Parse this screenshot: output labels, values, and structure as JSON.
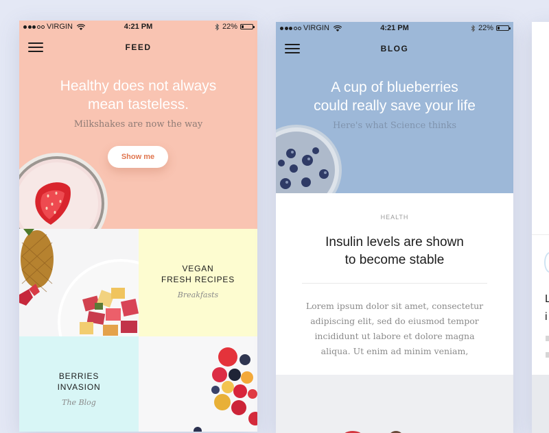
{
  "status_bar": {
    "carrier": "VIRGIN",
    "time": "4:21 PM",
    "battery_text": "22%",
    "battery_level": 0.22
  },
  "feed": {
    "nav_title": "FEED",
    "hero_title": "Healthy does not always\nmean tasteless.",
    "hero_subtitle": "Milkshakes are now the way",
    "cta_label": "Show me",
    "tiles": [
      {
        "title": "VEGAN\nFRESH RECIPES",
        "subtitle": "Breakfasts"
      },
      {
        "title": "BERRIES\nINVASION",
        "subtitle": "The Blog"
      }
    ]
  },
  "blog": {
    "nav_title": "BLOG",
    "hero_title": "A cup of blueberries\ncould really save your life",
    "hero_subtitle": "Here's what Science thinks",
    "category": "HEALTH",
    "post_title": "Insulin levels are shown\nto become stable",
    "post_excerpt": "Lorem ipsum dolor sit amet, consectetur\nadipiscing elit, sed do eiusmod tempor\nincididunt ut labore et dolore magna\naliqua. Ut enim ad minim veniam,"
  },
  "third_screen": {
    "letters": [
      "L",
      "i"
    ]
  },
  "colors": {
    "background": "#e4e8f5",
    "feed_hero": "#f9c4b2",
    "blog_hero": "#9db8d8",
    "vegan_tile": "#fdfcd0",
    "berries_tile": "#d8f6f6",
    "cta_text": "#e0764f"
  },
  "icons": [
    "signal-dots-icon",
    "wifi-icon",
    "bluetooth-icon",
    "battery-icon",
    "hamburger-menu-icon"
  ]
}
